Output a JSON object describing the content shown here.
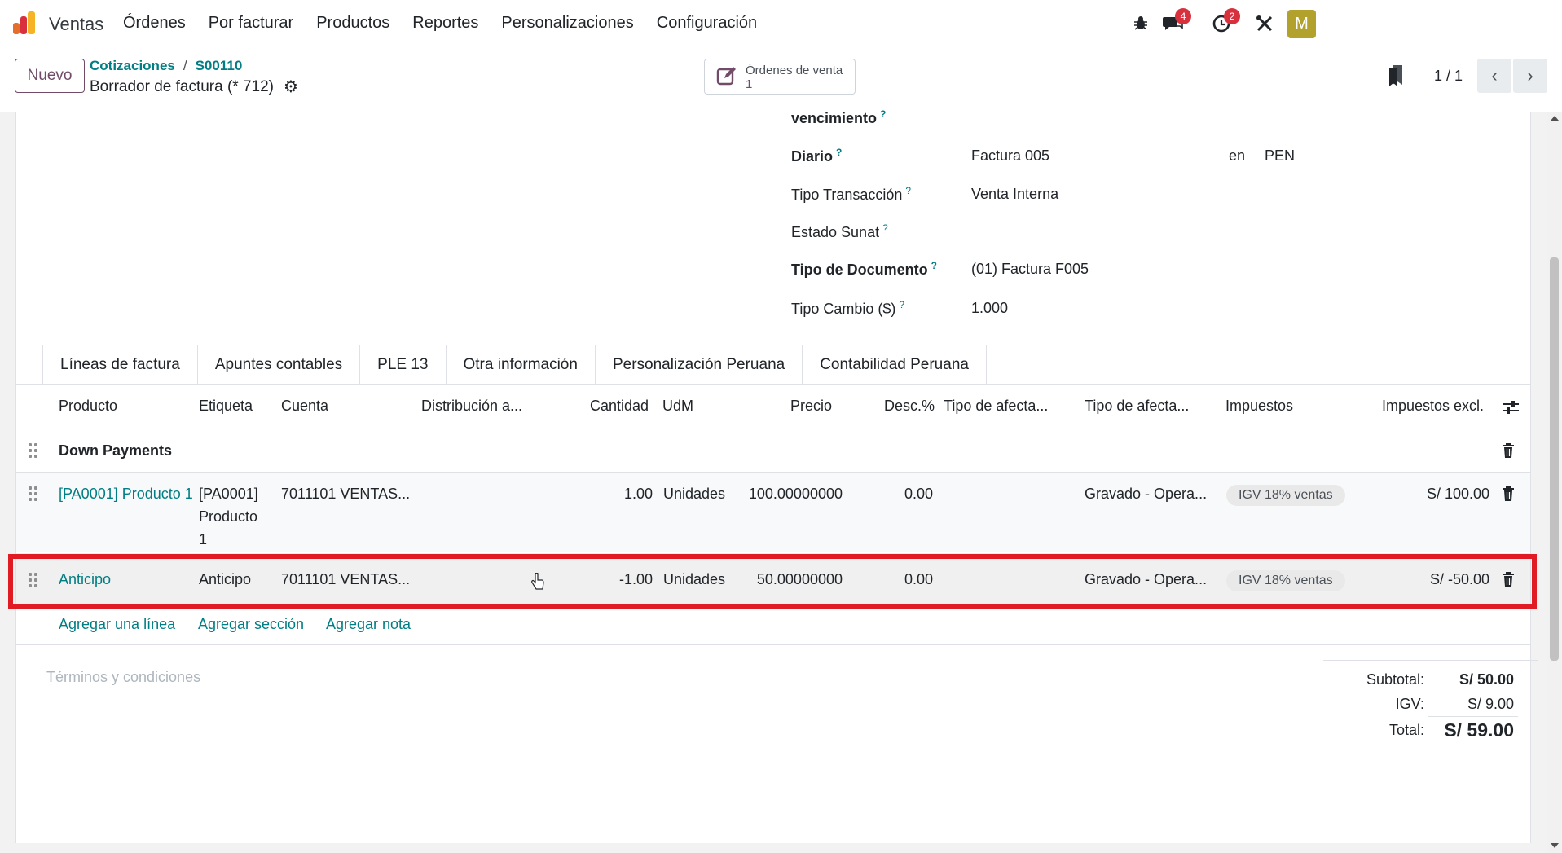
{
  "navbar": {
    "app_name": "Ventas",
    "menu": [
      "Órdenes",
      "Por facturar",
      "Productos",
      "Reportes",
      "Personalizaciones",
      "Configuración"
    ],
    "messages_badge": "4",
    "activities_badge": "2",
    "avatar_letter": "M"
  },
  "control": {
    "new_button": "Nuevo",
    "breadcrumb": [
      "Cotizaciones",
      "S00110"
    ],
    "breadcrumb_separator": "/",
    "record_title": "Borrador de factura (* 712)",
    "smart_button": {
      "label": "Órdenes de venta",
      "count": "1"
    },
    "pager": "1 / 1"
  },
  "form": {
    "fields": [
      {
        "label": "vencimiento",
        "value": "",
        "bold": true
      },
      {
        "label": "Diario",
        "value": "Factura 005",
        "extra_label": "en",
        "extra_value": "PEN",
        "bold": true
      },
      {
        "label": "Tipo Transacción",
        "value": "Venta Interna",
        "bold": false
      },
      {
        "label": "Estado Sunat",
        "value": "",
        "bold": false
      },
      {
        "label": "Tipo de Documento",
        "value": "(01) Factura F005",
        "bold": true
      },
      {
        "label": "Tipo Cambio ($)",
        "value": "1.000",
        "bold": false
      }
    ],
    "help_mark": "?"
  },
  "tabs": [
    "Líneas de factura",
    "Apuntes contables",
    "PLE 13",
    "Otra información",
    "Personalización Peruana",
    "Contabilidad Peruana"
  ],
  "table": {
    "headers": [
      "Producto",
      "Etiqueta",
      "Cuenta",
      "Distribución a...",
      "Cantidad",
      "UdM",
      "Precio",
      "Desc.%",
      "Tipo de afecta...",
      "Tipo de afecta...",
      "Impuestos",
      "Impuestos excl."
    ],
    "section_row": {
      "label": "Down Payments"
    },
    "rows": [
      {
        "product": "[PA0001] Producto 1",
        "label_lines": [
          "[PA0001]",
          "Producto",
          "1"
        ],
        "account": "7011101 VENTAS...",
        "quantity": "1.00",
        "uom": "Unidades",
        "price": "100.00000000",
        "discount": "0.00",
        "affect_type": "Gravado - Opera...",
        "tax": "IGV 18% ventas",
        "subtotal": "S/ 100.00"
      },
      {
        "product": "Anticipo",
        "label_lines": [
          "Anticipo"
        ],
        "account": "7011101 VENTAS...",
        "quantity": "-1.00",
        "uom": "Unidades",
        "price": "50.00000000",
        "discount": "0.00",
        "affect_type": "Gravado - Opera...",
        "tax": "IGV 18% ventas",
        "subtotal": "S/ -50.00"
      }
    ],
    "add_links": [
      "Agregar una línea",
      "Agregar sección",
      "Agregar nota"
    ]
  },
  "terms_placeholder": "Términos y condiciones",
  "totals": {
    "subtotal_label": "Subtotal:",
    "subtotal": "S/ 50.00",
    "tax_label": "IGV:",
    "tax": "S/ 9.00",
    "total_label": "Total:",
    "total": "S/ 59.00"
  },
  "colors": {
    "brand": "#714b67",
    "link": "#017e84",
    "highlight": "#e01b24",
    "badge": "#d9303e"
  }
}
